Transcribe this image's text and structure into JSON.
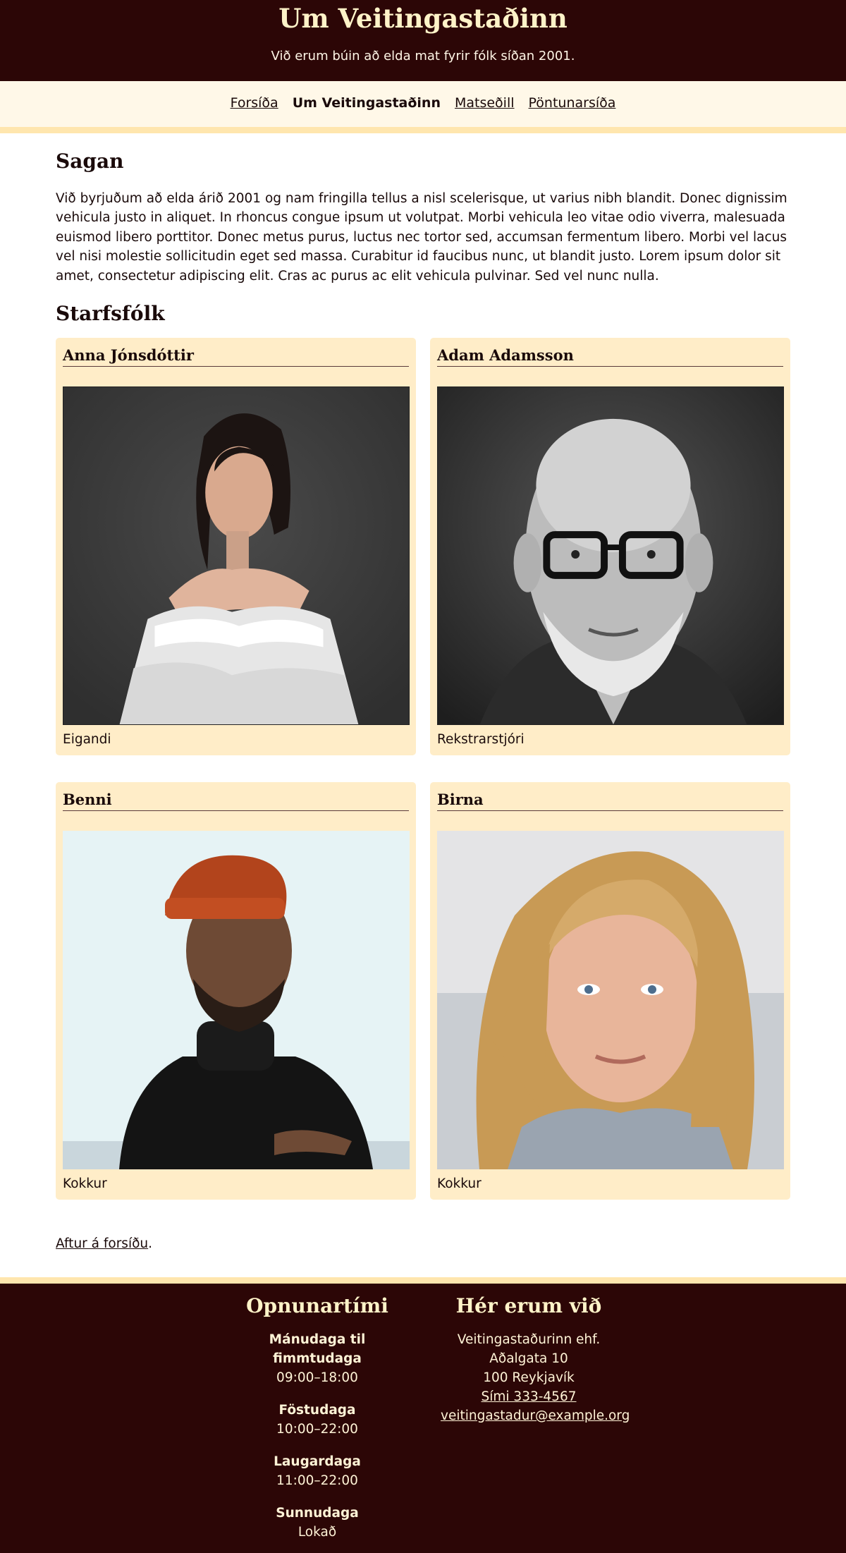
{
  "header": {
    "title": "Um Veitingastaðinn",
    "subtitle": "Við erum búin að elda mat fyrir fólk síðan 2001."
  },
  "nav": {
    "items": [
      {
        "label": "Forsíða",
        "current": false
      },
      {
        "label": "Um Veitingastaðinn",
        "current": true
      },
      {
        "label": "Matseðill",
        "current": false
      },
      {
        "label": "Pöntunarsíða",
        "current": false
      }
    ]
  },
  "saga": {
    "heading": "Sagan",
    "text": "Við byrjuðum að elda árið 2001 og nam fringilla tellus a nisl scelerisque, ut varius nibh blandit. Donec dignissim vehicula justo in aliquet. In rhoncus congue ipsum ut volutpat. Morbi vehicula leo vitae odio viverra, malesuada euismod libero porttitor. Donec metus purus, luctus nec tortor sed, accumsan fermentum libero. Morbi vel lacus vel nisi molestie sollicitudin eget sed massa. Curabitur id faucibus nunc, ut blandit justo. Lorem ipsum dolor sit amet, consectetur adipiscing elit. Cras ac purus ac elit vehicula pulvinar. Sed vel nunc nulla."
  },
  "staff": {
    "heading": "Starfsfólk",
    "members": [
      {
        "name": "Anna Jónsdóttir",
        "role": "Eigandi"
      },
      {
        "name": "Adam Adamsson",
        "role": "Rekstrarstjóri"
      },
      {
        "name": "Benni",
        "role": "Kokkur"
      },
      {
        "name": "Birna",
        "role": "Kokkur"
      }
    ]
  },
  "back": {
    "link": "Aftur á forsíðu",
    "suffix": "."
  },
  "footer": {
    "hours": {
      "heading": "Opnunartími",
      "rows": [
        {
          "day": "Mánudaga til fimmtudaga",
          "time": "09:00–18:00"
        },
        {
          "day": "Föstudaga",
          "time": "10:00–22:00"
        },
        {
          "day": "Laugardaga",
          "time": "11:00–22:00"
        },
        {
          "day": "Sunnudaga",
          "time": "Lokað"
        }
      ]
    },
    "contact": {
      "heading": "Hér erum við",
      "company": "Veitingastaðurinn ehf.",
      "street": "Aðalgata 10",
      "city": "100 Reykjavík",
      "phone": "Sími 333-4567",
      "email": "veitingastadur@example.org"
    }
  },
  "colors": {
    "dark": "#2c0606",
    "cream": "#fff8e8",
    "card": "#ffedc8",
    "accent": "#ffe6ae"
  }
}
